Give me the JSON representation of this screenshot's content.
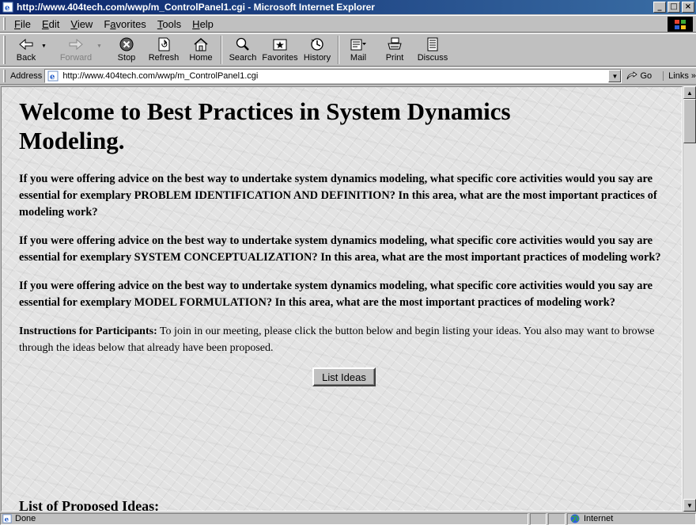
{
  "window": {
    "title": "http://www.404tech.com/wwp/m_ControlPanel1.cgi - Microsoft Internet Explorer",
    "buttons": {
      "minimize": "_",
      "maximize": "□",
      "close": "×"
    }
  },
  "menu": {
    "items": [
      {
        "label": "File",
        "accesskey": "F",
        "rest": "ile"
      },
      {
        "label": "Edit",
        "accesskey": "E",
        "rest": "dit"
      },
      {
        "label": "View",
        "accesskey": "V",
        "rest": "iew"
      },
      {
        "label": "Favorites",
        "pre": "F",
        "accesskey": "a",
        "rest": "vorites"
      },
      {
        "label": "Tools",
        "accesskey": "T",
        "rest": "ools"
      },
      {
        "label": "Help",
        "accesskey": "H",
        "rest": "elp"
      }
    ]
  },
  "toolbar": {
    "back": "Back",
    "forward": "Forward",
    "stop": "Stop",
    "refresh": "Refresh",
    "home": "Home",
    "search": "Search",
    "favorites": "Favorites",
    "history": "History",
    "mail": "Mail",
    "print": "Print",
    "discuss": "Discuss"
  },
  "address": {
    "label": "Address",
    "url": "http://www.404tech.com/wwp/m_ControlPanel1.cgi",
    "go": "Go",
    "links": "Links »"
  },
  "page": {
    "heading": "Welcome to Best Practices in System Dynamics Modeling.",
    "questions": [
      "If you were offering advice on the best way to undertake system dynamics modeling, what specific core activities would you say are essential for exemplary PROBLEM IDENTIFICATION AND DEFINITION? In this area, what are the most important practices of modeling work?",
      "If you were offering advice on the best way to undertake system dynamics modeling, what specific core activities would you say are essential for exemplary SYSTEM CONCEPTUALIZATION? In this area, what are the most important practices of modeling work?",
      "If you were offering advice on the best way to undertake system dynamics modeling, what specific core activities would you say are essential for exemplary MODEL FORMULATION? In this area, what are the most important practices of modeling work?"
    ],
    "instructions_label": "Instructions for Participants:",
    "instructions_text": " To join in our meeting, please click the button below and begin listing your ideas. You also may want to browse through the ideas below that already have been proposed.",
    "list_ideas_button": "List Ideas",
    "proposed_heading": "List of Proposed Ideas:"
  },
  "status": {
    "text": "Done",
    "zone": "Internet"
  },
  "colors": {
    "titlebar_start": "#0a246a",
    "titlebar_end": "#3a6ea5",
    "chrome": "#c0c0c0"
  }
}
